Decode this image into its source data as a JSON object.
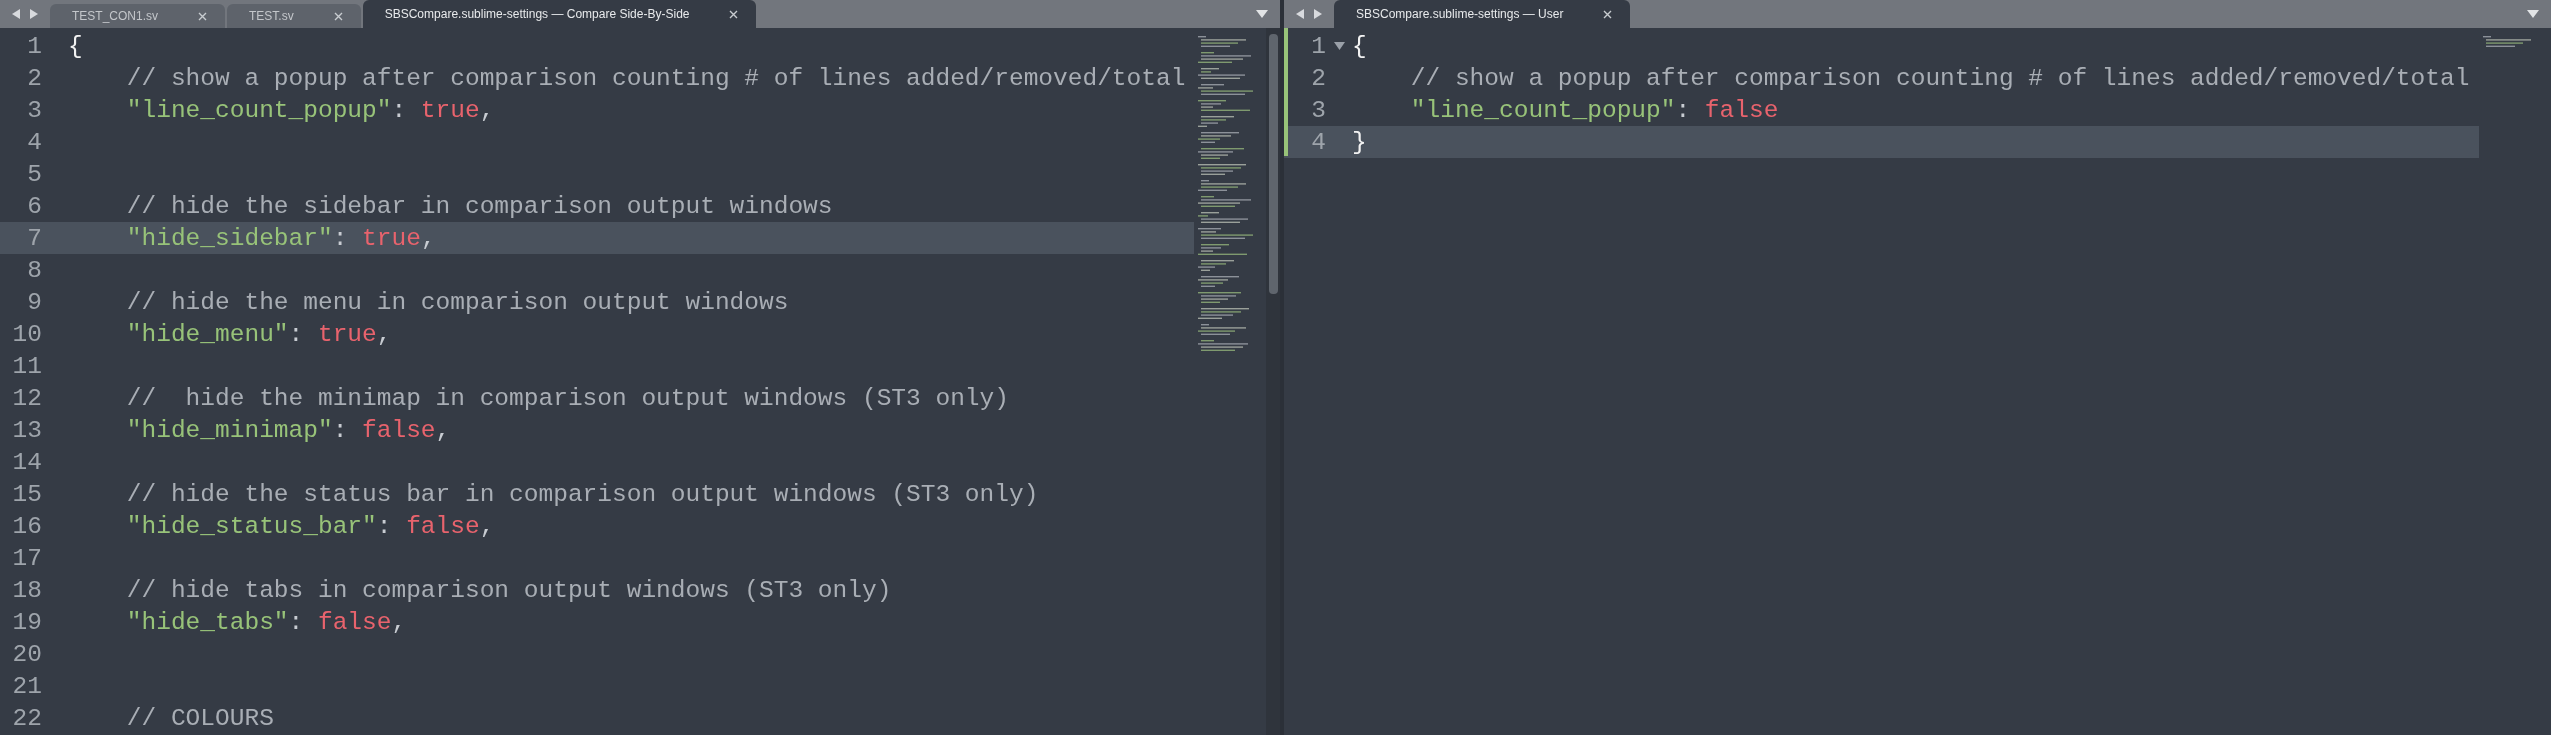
{
  "panes": [
    {
      "tabs": [
        {
          "label": "TEST_CON1.sv",
          "selected": false
        },
        {
          "label": "TEST.sv",
          "selected": false
        },
        {
          "label": "SBSCompare.sublime-settings — Compare Side-By-Side",
          "selected": true
        }
      ],
      "modified": false,
      "scrollbar": true,
      "lines": [
        {
          "number": "1",
          "current": false,
          "fold": false,
          "tokens": [
            {
              "kind": "brace",
              "text": "{"
            }
          ]
        },
        {
          "number": "2",
          "current": false,
          "fold": false,
          "tokens": [
            {
              "kind": "comment",
              "text": "    // show a popup after comparison counting # of lines added/removed/total"
            }
          ]
        },
        {
          "number": "3",
          "current": false,
          "fold": false,
          "tokens": [
            {
              "kind": "key",
              "text": "    \"line_count_popup\""
            },
            {
              "kind": "punct",
              "text": ": "
            },
            {
              "kind": "bool",
              "text": "true"
            },
            {
              "kind": "punct",
              "text": ","
            }
          ]
        },
        {
          "number": "4",
          "current": false,
          "fold": false
        },
        {
          "number": "5",
          "current": false,
          "fold": false
        },
        {
          "number": "6",
          "current": false,
          "fold": false,
          "tokens": [
            {
              "kind": "comment",
              "text": "    // hide the sidebar in comparison output windows"
            }
          ]
        },
        {
          "number": "7",
          "current": true,
          "fold": false,
          "tokens": [
            {
              "kind": "key",
              "text": "    \"hide_sidebar\""
            },
            {
              "kind": "punct",
              "text": ": "
            },
            {
              "kind": "bool",
              "text": "true"
            },
            {
              "kind": "punct",
              "text": ","
            }
          ]
        },
        {
          "number": "8",
          "current": false,
          "fold": false
        },
        {
          "number": "9",
          "current": false,
          "fold": false,
          "tokens": [
            {
              "kind": "comment",
              "text": "    // hide the menu in comparison output windows"
            }
          ]
        },
        {
          "number": "10",
          "current": false,
          "fold": false,
          "tokens": [
            {
              "kind": "key",
              "text": "    \"hide_menu\""
            },
            {
              "kind": "punct",
              "text": ": "
            },
            {
              "kind": "bool",
              "text": "true"
            },
            {
              "kind": "punct",
              "text": ","
            }
          ]
        },
        {
          "number": "11",
          "current": false,
          "fold": false
        },
        {
          "number": "12",
          "current": false,
          "fold": false,
          "tokens": [
            {
              "kind": "comment",
              "text": "    //  hide the minimap in comparison output windows (ST3 only)"
            }
          ]
        },
        {
          "number": "13",
          "current": false,
          "fold": false,
          "tokens": [
            {
              "kind": "key",
              "text": "    \"hide_minimap\""
            },
            {
              "kind": "punct",
              "text": ": "
            },
            {
              "kind": "bool",
              "text": "false"
            },
            {
              "kind": "punct",
              "text": ","
            }
          ]
        },
        {
          "number": "14",
          "current": false,
          "fold": false
        },
        {
          "number": "15",
          "current": false,
          "fold": false,
          "tokens": [
            {
              "kind": "comment",
              "text": "    // hide the status bar in comparison output windows (ST3 only)"
            }
          ]
        },
        {
          "number": "16",
          "current": false,
          "fold": false,
          "tokens": [
            {
              "kind": "key",
              "text": "    \"hide_status_bar\""
            },
            {
              "kind": "punct",
              "text": ": "
            },
            {
              "kind": "bool",
              "text": "false"
            },
            {
              "kind": "punct",
              "text": ","
            }
          ]
        },
        {
          "number": "17",
          "current": false,
          "fold": false
        },
        {
          "number": "18",
          "current": false,
          "fold": false,
          "tokens": [
            {
              "kind": "comment",
              "text": "    // hide tabs in comparison output windows (ST3 only)"
            }
          ]
        },
        {
          "number": "19",
          "current": false,
          "fold": false,
          "tokens": [
            {
              "kind": "key",
              "text": "    \"hide_tabs\""
            },
            {
              "kind": "punct",
              "text": ": "
            },
            {
              "kind": "bool",
              "text": "false"
            },
            {
              "kind": "punct",
              "text": ","
            }
          ]
        },
        {
          "number": "20",
          "current": false,
          "fold": false
        },
        {
          "number": "21",
          "current": false,
          "fold": false
        },
        {
          "number": "22",
          "current": false,
          "fold": false,
          "tokens": [
            {
              "kind": "comment",
              "text": "    // COLOURS"
            }
          ]
        }
      ]
    },
    {
      "tabs": [
        {
          "label": "SBSCompare.sublime-settings — User",
          "selected": true
        }
      ],
      "modified": true,
      "scrollbar": false,
      "lines": [
        {
          "number": "1",
          "current": false,
          "fold": true,
          "tokens": [
            {
              "kind": "brace",
              "text": "{"
            }
          ]
        },
        {
          "number": "2",
          "current": false,
          "fold": false,
          "tokens": [
            {
              "kind": "comment",
              "text": "    // show a popup after comparison counting # of lines added/removed/total"
            }
          ]
        },
        {
          "number": "3",
          "current": false,
          "fold": false,
          "tokens": [
            {
              "kind": "key",
              "text": "    \"line_count_popup\""
            },
            {
              "kind": "punct",
              "text": ": "
            },
            {
              "kind": "bool",
              "text": "false"
            }
          ]
        },
        {
          "number": "4",
          "current": true,
          "fold": false,
          "tokens": [
            {
              "kind": "brace",
              "text": "}"
            }
          ]
        }
      ]
    }
  ]
}
